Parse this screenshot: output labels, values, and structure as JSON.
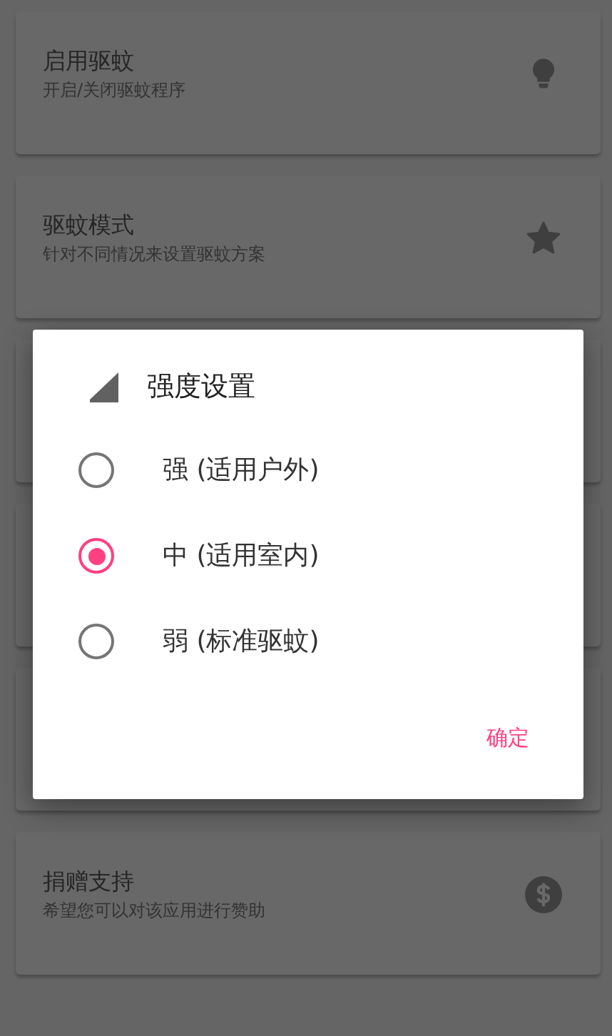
{
  "settings": [
    {
      "kind": "item",
      "title": "启用驱蚊",
      "subtitle": "开启/关闭驱蚊程序"
    },
    {
      "kind": "item",
      "title": "驱蚊模式",
      "subtitle": "针对不同情况来设置驱蚊方案"
    },
    {
      "kind": "covered"
    },
    {
      "kind": "covered"
    },
    {
      "kind": "covered"
    },
    {
      "kind": "item",
      "title": "捐赠支持",
      "subtitle": "希望您可以对该应用进行赞助"
    }
  ],
  "dialog": {
    "title": "强度设置",
    "options": [
      {
        "label": "强 (适用户外)",
        "selected": false
      },
      {
        "label": "中 (适用室内)",
        "selected": true
      },
      {
        "label": "弱 (标准驱蚊)",
        "selected": false
      }
    ],
    "button": "确定"
  }
}
